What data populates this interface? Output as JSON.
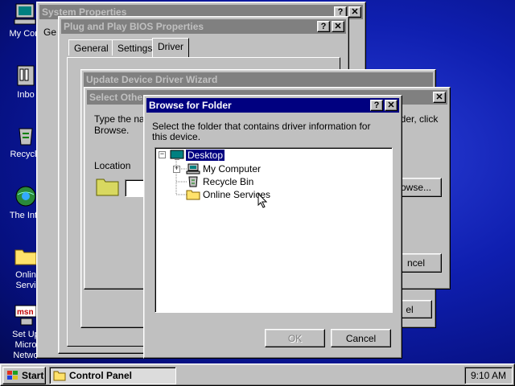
{
  "desktop": {
    "icons": [
      {
        "label": "My Com",
        "icon": "my-computer-icon"
      },
      {
        "label": "Inbo",
        "icon": "inbox-icon"
      },
      {
        "label": "Recycle",
        "icon": "recycle-bin-icon"
      },
      {
        "label": "The Inte",
        "icon": "internet-icon"
      },
      {
        "label": "Onlin",
        "label2": "Servi",
        "icon": "folder-icon"
      },
      {
        "label": "Set Up",
        "label2": "Micro",
        "label3": "Netwo",
        "icon": "msn-icon"
      }
    ]
  },
  "system_properties": {
    "title": "System Properties",
    "tab_partial": "Ge"
  },
  "pnp_bios": {
    "title": "Plug and Play BIOS Properties",
    "tabs": [
      "General",
      "Settings",
      "Driver"
    ]
  },
  "update_wizard": {
    "title": "Update Device Driver Wizard"
  },
  "select_other": {
    "title": "Select Othe",
    "text_line1": "Type the na",
    "text_line2": "Browse.",
    "text_right": "lder, click",
    "location_label": "Location",
    "browse_button": "owse...",
    "cancel_button": "ncel"
  },
  "wizard_back": {
    "cancel_partial": "el"
  },
  "browse_dialog": {
    "title": "Browse for Folder",
    "instructions_line1": "Select the folder that contains driver information for",
    "instructions_line2": "this device.",
    "tree": [
      {
        "label": "Desktop",
        "selected": true,
        "icon": "desktop-icon"
      },
      {
        "label": "My Computer",
        "icon": "my-computer-icon"
      },
      {
        "label": "Recycle Bin",
        "icon": "recycle-bin-icon"
      },
      {
        "label": "Online Services",
        "icon": "folder-icon"
      }
    ],
    "ok_button": "OK",
    "cancel_button": "Cancel"
  },
  "taskbar": {
    "start_label": "Start",
    "task_label": "Control Panel",
    "clock": "9:10 AM"
  },
  "colors": {
    "title_active": "#000080",
    "title_inactive": "#808080",
    "face": "#c0c0c0"
  }
}
